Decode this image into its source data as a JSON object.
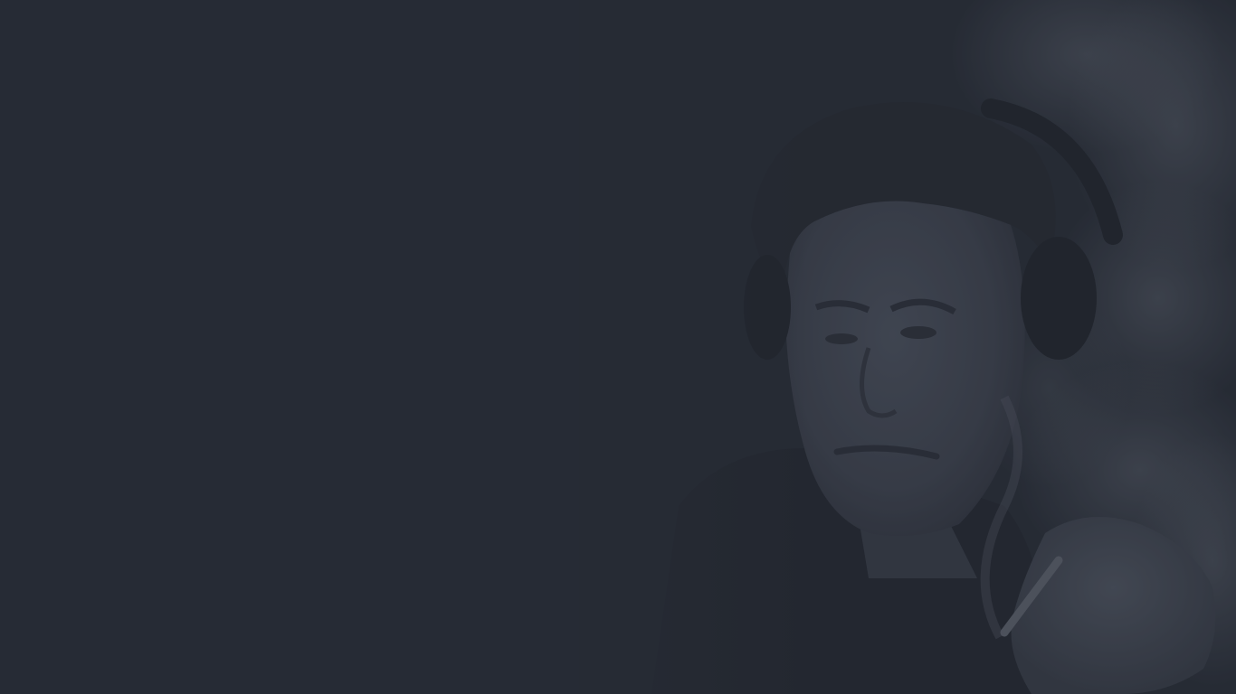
{
  "page": {
    "background_color": "#262b35",
    "overlay_tint": "#2a303c"
  },
  "background_image": {
    "subject": "person-with-headphones-smoking-portrait",
    "treatment": "dark-desaturated-overlay",
    "smoke_color": "#4a4f5b",
    "skin_tone_color": "#3e4350",
    "hair_color": "#262a34"
  }
}
